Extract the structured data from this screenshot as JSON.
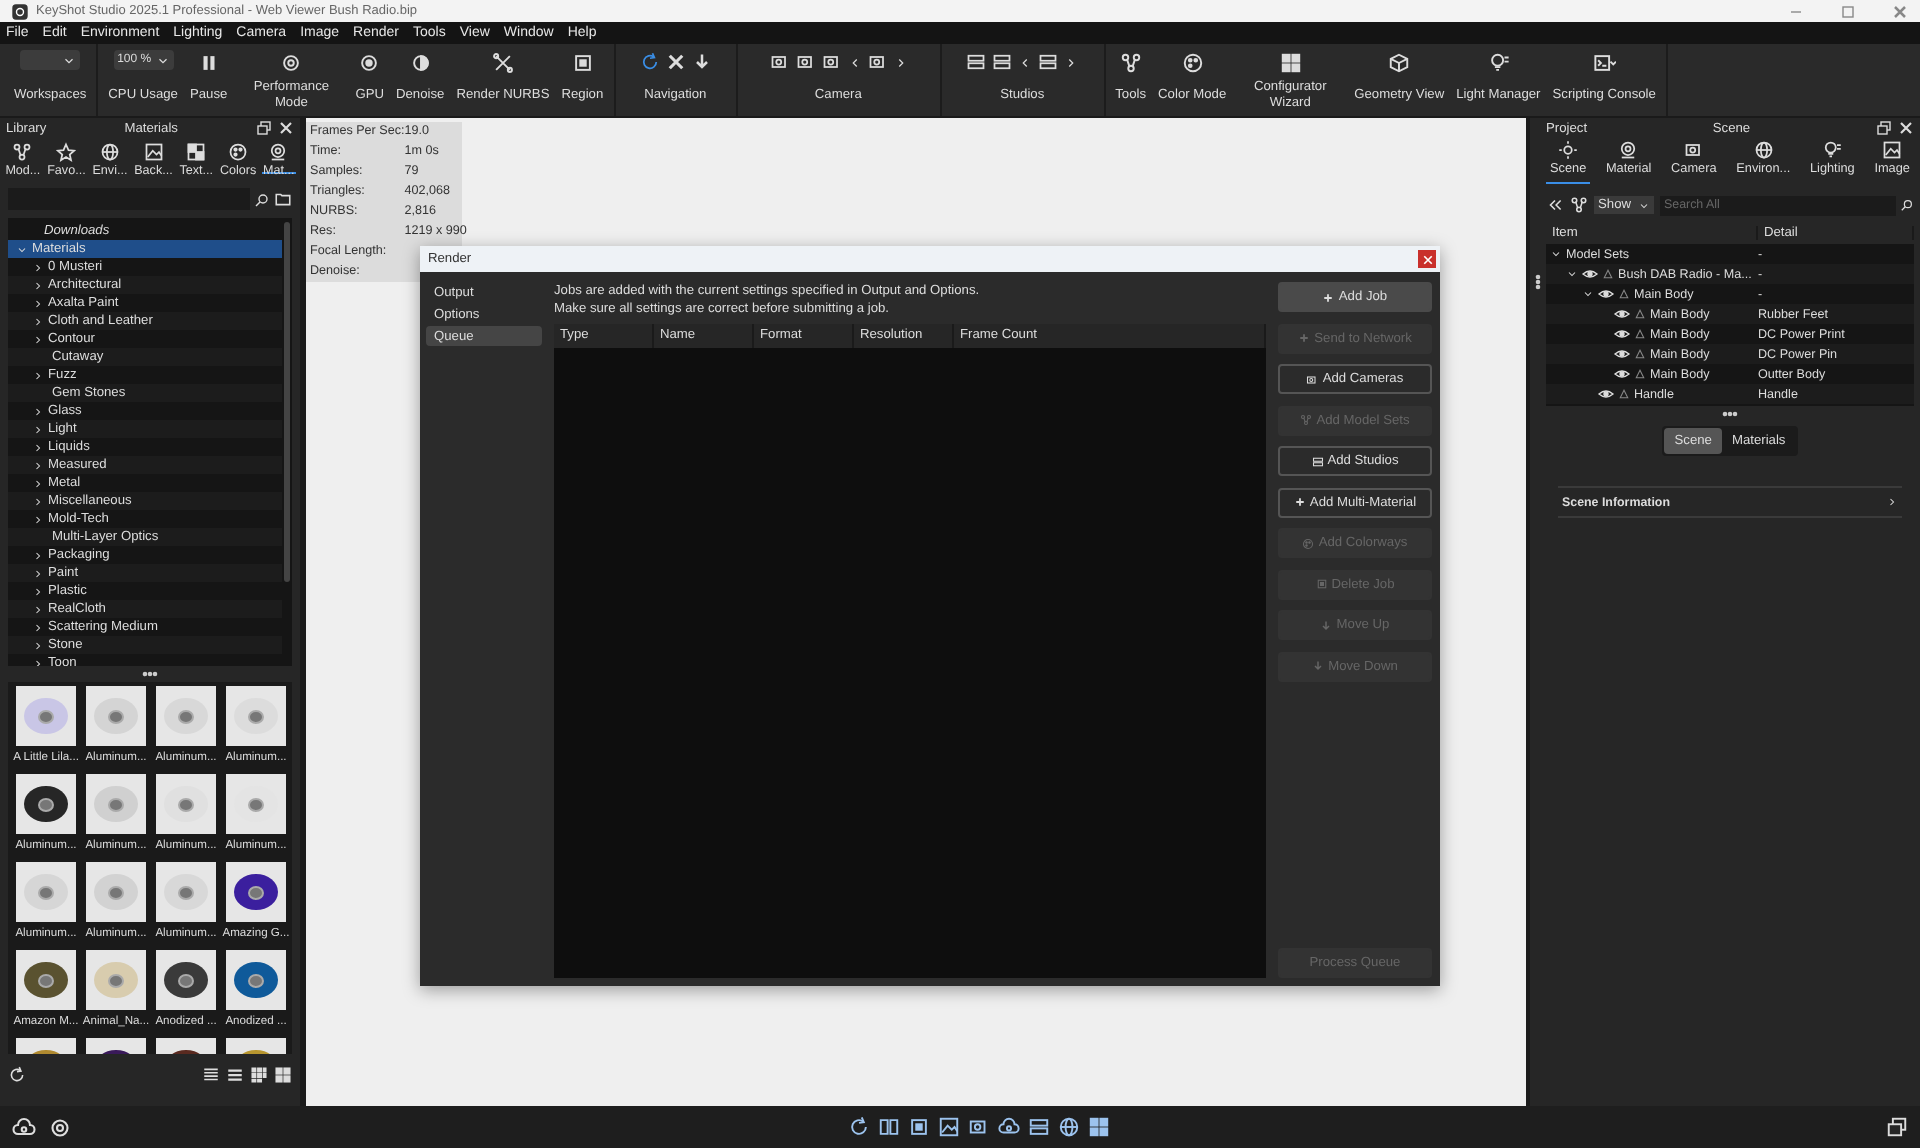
{
  "window": {
    "title": "KeyShot Studio 2025.1 Professional  - Web Viewer Bush Radio.bip"
  },
  "menu": [
    "File",
    "Edit",
    "Environment",
    "Lighting",
    "Camera",
    "Image",
    "Render",
    "Tools",
    "View",
    "Window",
    "Help"
  ],
  "toolbar": [
    {
      "kind": "dropdown",
      "label": "Workspaces"
    },
    {
      "kind": "dropdown",
      "label": "CPU Usage",
      "value": "100 %"
    },
    {
      "kind": "button",
      "label": "Pause"
    },
    {
      "kind": "button",
      "label": "Performance Mode"
    },
    {
      "kind": "button",
      "label": "GPU"
    },
    {
      "kind": "button",
      "label": "Denoise"
    },
    {
      "kind": "button",
      "label": "Render NURBS"
    },
    {
      "kind": "button",
      "label": "Region"
    },
    {
      "kind": "group",
      "label": "Navigation"
    },
    {
      "kind": "group",
      "label": "Camera"
    },
    {
      "kind": "group",
      "label": "Studios"
    },
    {
      "kind": "button",
      "label": "Tools"
    },
    {
      "kind": "button",
      "label": "Color Mode"
    },
    {
      "kind": "button",
      "label": "Configurator Wizard"
    },
    {
      "kind": "button",
      "label": "Geometry View"
    },
    {
      "kind": "button",
      "label": "Light Manager"
    },
    {
      "kind": "button",
      "label": "Scripting Console"
    }
  ],
  "library": {
    "title": "Library",
    "heading": "Materials",
    "tabs": [
      {
        "label": "Mod...",
        "selected": false
      },
      {
        "label": "Favo...",
        "selected": false
      },
      {
        "label": "Envi...",
        "selected": false
      },
      {
        "label": "Back...",
        "selected": false
      },
      {
        "label": "Text...",
        "selected": false
      },
      {
        "label": "Colors",
        "selected": false
      },
      {
        "label": "Mat...",
        "selected": true
      }
    ],
    "tree": [
      {
        "label": "Downloads",
        "selected": false
      },
      {
        "label": "Materials",
        "selected": true,
        "expanded": true,
        "children": [
          {
            "label": "0 Musteri",
            "selected": false,
            "expanded": false
          },
          {
            "label": "Architectural",
            "selected": false,
            "expanded": false
          },
          {
            "label": "Axalta Paint",
            "selected": false,
            "expanded": false
          },
          {
            "label": "Cloth and Leather",
            "selected": false,
            "expanded": false
          },
          {
            "label": "Contour",
            "selected": false,
            "expanded": false
          },
          {
            "label": "Cutaway",
            "selected": false
          },
          {
            "label": "Fuzz",
            "selected": false,
            "expanded": false
          },
          {
            "label": "Gem Stones",
            "selected": false
          },
          {
            "label": "Glass",
            "selected": false,
            "expanded": false
          },
          {
            "label": "Light",
            "selected": false,
            "expanded": false
          },
          {
            "label": "Liquids",
            "selected": false,
            "expanded": false
          },
          {
            "label": "Measured",
            "selected": false,
            "expanded": false
          },
          {
            "label": "Metal",
            "selected": false,
            "expanded": false
          },
          {
            "label": "Miscellaneous",
            "selected": false,
            "expanded": false
          },
          {
            "label": "Mold-Tech",
            "selected": false,
            "expanded": false
          },
          {
            "label": "Multi-Layer Optics",
            "selected": false
          },
          {
            "label": "Packaging",
            "selected": false,
            "expanded": false
          },
          {
            "label": "Paint",
            "selected": false,
            "expanded": false
          },
          {
            "label": "Plastic",
            "selected": false,
            "expanded": false
          },
          {
            "label": "RealCloth",
            "selected": false,
            "expanded": false
          },
          {
            "label": "Scattering Medium",
            "selected": false,
            "expanded": false
          },
          {
            "label": "Stone",
            "selected": false,
            "expanded": false
          },
          {
            "label": "Toon",
            "selected": false,
            "expanded": false
          }
        ]
      }
    ],
    "thumbnails": [
      {
        "label": "A Little Lila...",
        "color": "#c9c6e6"
      },
      {
        "label": "Aluminum...",
        "color": "#d4d4d4"
      },
      {
        "label": "Aluminum...",
        "color": "#d8d8d8"
      },
      {
        "label": "Aluminum...",
        "color": "#dcdcdc"
      },
      {
        "label": "Aluminum...",
        "color": "#262626"
      },
      {
        "label": "Aluminum...",
        "color": "#d0d0d0"
      },
      {
        "label": "Aluminum...",
        "color": "#e0e0e0"
      },
      {
        "label": "Aluminum...",
        "color": "#e4e4e4"
      },
      {
        "label": "Aluminum...",
        "color": "#d6d6d6"
      },
      {
        "label": "Aluminum...",
        "color": "#d2d2d2"
      },
      {
        "label": "Aluminum...",
        "color": "#d8d8d8"
      },
      {
        "label": "Amazing G...",
        "color": "#3b1f9e"
      },
      {
        "label": "Amazon M...",
        "color": "#5a5230"
      },
      {
        "label": "Animal_Na...",
        "color": "#d8ccae"
      },
      {
        "label": "Anodized ...",
        "color": "#3a3a3a"
      },
      {
        "label": "Anodized ...",
        "color": "#0f5a9a"
      },
      {
        "color": "#b08a30"
      },
      {
        "color": "#3a1a5a"
      },
      {
        "color": "#5a2a20"
      },
      {
        "color": "#b8962f"
      }
    ]
  },
  "stats": [
    {
      "label": "Frames Per Sec:",
      "value": "19.0"
    },
    {
      "label": "Time:",
      "value": "1m 0s"
    },
    {
      "label": "Samples:",
      "value": "79"
    },
    {
      "label": "Triangles:",
      "value": "402,068"
    },
    {
      "label": "NURBS:",
      "value": "2,816"
    },
    {
      "label": "Res:",
      "value": "1219 x 990"
    },
    {
      "label": "Focal Length:"
    },
    {
      "label": "Denoise:"
    }
  ],
  "render_dialog": {
    "title": "Render",
    "nav": [
      {
        "label": "Output",
        "selected": false
      },
      {
        "label": "Options",
        "selected": false
      },
      {
        "label": "Queue",
        "selected": true
      }
    ],
    "info": [
      "Jobs are added with the current settings specified in Output and Options.",
      "Make sure all settings are correct before submitting a job."
    ],
    "columns": [
      "Type",
      "Name",
      "Format",
      "Resolution",
      "Frame Count"
    ],
    "buttons": [
      {
        "label": "Add Job",
        "disabled": false
      },
      {
        "label": "Send to Network",
        "disabled": true
      },
      {
        "label": "Add Cameras",
        "disabled": false
      },
      {
        "label": "Add Model Sets",
        "disabled": true
      },
      {
        "label": "Add Studios",
        "disabled": false
      },
      {
        "label": "Add Multi-Material",
        "disabled": false
      },
      {
        "label": "Add Colorways",
        "disabled": true
      },
      {
        "label": "Delete Job",
        "disabled": true
      },
      {
        "label": "Move Up",
        "disabled": true
      },
      {
        "label": "Move Down",
        "disabled": true
      }
    ],
    "process_button": {
      "label": "Process Queue",
      "disabled": true
    }
  },
  "project": {
    "title": "Project",
    "heading": "Scene",
    "tabs": [
      {
        "label": "Scene",
        "selected": true
      },
      {
        "label": "Material",
        "selected": false
      },
      {
        "label": "Camera",
        "selected": false
      },
      {
        "label": "Environ...",
        "selected": false
      },
      {
        "label": "Lighting",
        "selected": false
      },
      {
        "label": "Image",
        "selected": false
      }
    ],
    "show": "Show",
    "search": {
      "placeholder": "Search All"
    },
    "columns": [
      "Item",
      "Detail"
    ],
    "tree": [
      {
        "item": "Model Sets",
        "detail": "-",
        "expanded": true,
        "children": [
          {
            "item": "Bush DAB Radio - Ma...",
            "detail": "-",
            "visible": true,
            "expanded": true,
            "children": [
              {
                "item": "Main Body",
                "detail": "-",
                "visible": true,
                "expanded": true,
                "children": [
                  {
                    "item": "Main Body",
                    "detail": "Rubber Feet",
                    "visible": true
                  },
                  {
                    "item": "Main Body",
                    "detail": "DC Power Print",
                    "visible": true
                  },
                  {
                    "item": "Main Body",
                    "detail": "DC Power Pin",
                    "visible": true
                  },
                  {
                    "item": "Main Body",
                    "detail": "Outter Body",
                    "visible": true
                  }
                ]
              },
              {
                "item": "Handle",
                "detail": "Handle",
                "visible": true
              }
            ]
          }
        ]
      }
    ],
    "segments": [
      {
        "label": "Scene",
        "selected": true
      },
      {
        "label": "Materials",
        "selected": false
      }
    ],
    "section": "Scene Information"
  }
}
